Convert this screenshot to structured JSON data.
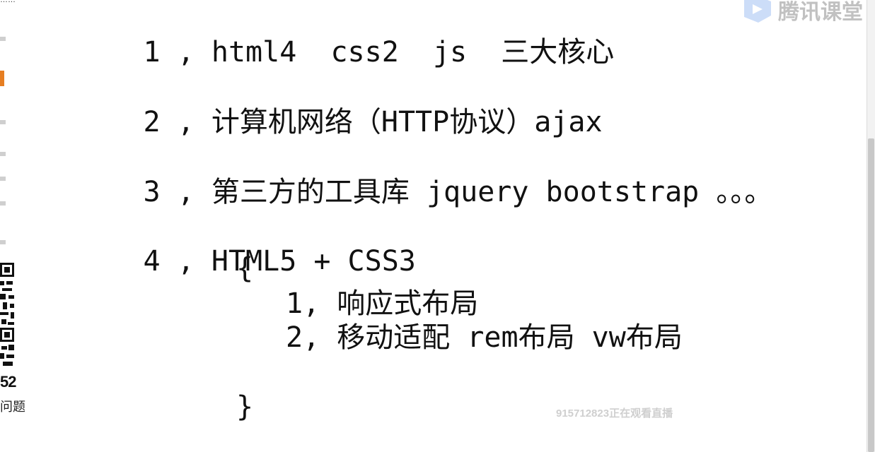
{
  "window": {
    "title_fragment": "……"
  },
  "left_panel": {
    "count": "52",
    "label": "问题"
  },
  "watermark": {
    "brand": "腾讯课堂",
    "viewers_text": "915712823正在观看直播"
  },
  "editor": {
    "lines": [
      {
        "num": "1",
        "sep": ",",
        "text": "html4  css2  js  三大核心"
      },
      {
        "num": "2",
        "sep": ",",
        "text": "计算机网络（HTTP协议）ajax"
      },
      {
        "num": "3",
        "sep": ",",
        "text": "第三方的工具库 jquery bootstrap 。。。"
      },
      {
        "num": "4",
        "sep": ",",
        "text": "HTML5 + CSS3"
      }
    ],
    "brace_open": "{",
    "brace_close": "}",
    "sub_items": [
      "1, 响应式布局",
      "2, 移动适配 rem布局 vw布局"
    ]
  },
  "colors": {
    "text": "#111111",
    "background": "#ffffff",
    "scrollbar_thumb": "#c8c8c8",
    "watermark": "#777777"
  },
  "icons": [
    "tencent-classroom-logo-icon",
    "qr-code-icon"
  ]
}
